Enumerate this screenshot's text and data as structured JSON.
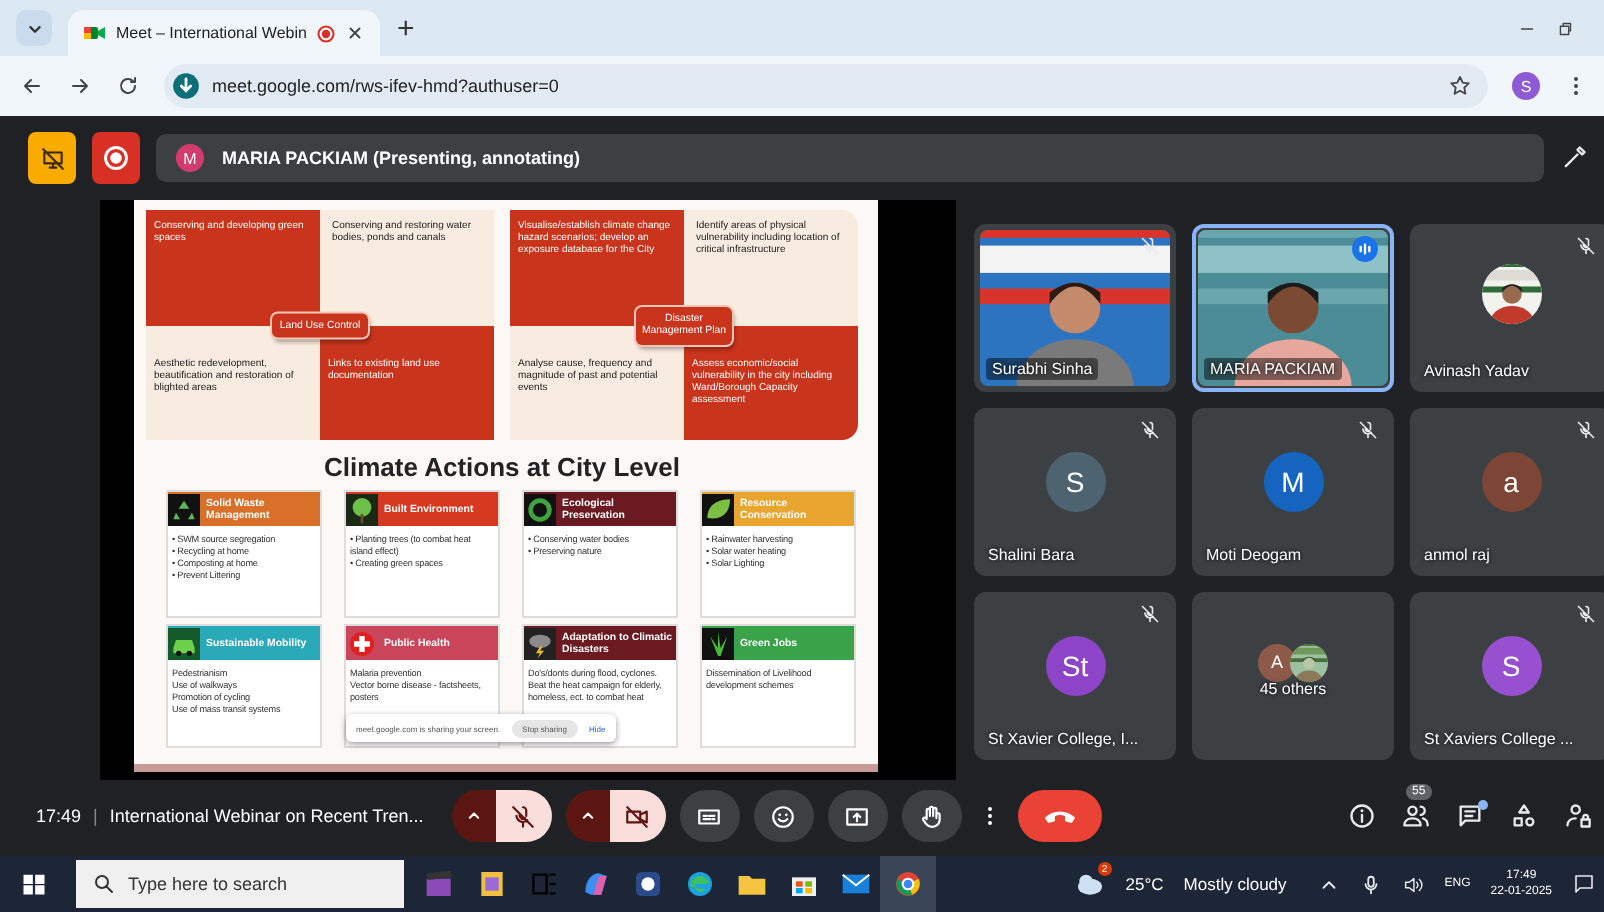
{
  "browser": {
    "tab_title": "Meet – International Webin",
    "new_tab": "+",
    "url": "meet.google.com/rws-ifev-hmd?authuser=0",
    "profile_initial": "S"
  },
  "meet_bar": {
    "presenter_initial": "M",
    "presenter": "MARIA PACKIAM (Presenting, annotating)"
  },
  "slide": {
    "quadrant_groups": [
      {
        "center": "Land Use Control",
        "cells": [
          {
            "text": "Conserving and developing green spaces",
            "color": "#c8341c"
          },
          {
            "text": "Conserving and restoring water bodies, ponds and canals",
            "color": "#f8ebe0"
          },
          {
            "text": "Aesthetic redevelopment, beautification and restoration of blighted areas",
            "color": "#f8ebe0"
          },
          {
            "text": "Links to existing  land use documentation",
            "color": "#c8341c"
          }
        ]
      },
      {
        "center": "Disaster Management Plan",
        "cells": [
          {
            "text": "Visualise/establish climate change hazard scenarios; develop an exposure database for the City",
            "color": "#c8341c"
          },
          {
            "text": "Identify areas of physical vulnerability including location of critical infrastructure",
            "color": "#f8ebe0"
          },
          {
            "text": "Analyse cause, frequency and magnitude of past and potential events",
            "color": "#f8ebe0"
          },
          {
            "text": "Assess economic/social vulnerability in the city including Ward/Borough Capacity assessment",
            "color": "#c8341c"
          }
        ]
      }
    ],
    "title": "Climate Actions at City Level",
    "cards": [
      {
        "title": "Solid Waste Management",
        "color": "#d9702a",
        "lines": [
          "• SWM source segregation",
          "• Recycling at home",
          "• Composting at home",
          "• Prevent Littering"
        ]
      },
      {
        "title": "Built Environment",
        "color": "#d6391f",
        "lines": [
          "• Planting trees (to combat heat island effect)",
          "• Creating green spaces"
        ]
      },
      {
        "title": "Ecological Preservation",
        "color": "#6b1a22",
        "lines": [
          "• Conserving water bodies",
          "• Preserving nature"
        ]
      },
      {
        "title": "Resource Conservation",
        "color": "#e8a530",
        "lines": [
          "• Rainwater harvesting",
          "• Solar water heating",
          "• Solar Lighting"
        ]
      },
      {
        "title": "Sustainable Mobility",
        "color": "#2aaab8",
        "lines": [
          "Pedestrianism",
          "Use of walkways",
          "Promotion of cycling",
          "Use of mass transit systems"
        ]
      },
      {
        "title": "Public Health",
        "color": "#c9455a",
        "lines": [
          "Malaria prevention",
          "Vector borne disease - factsheets, posters"
        ]
      },
      {
        "title": "Adaptation to Climatic Disasters",
        "color": "#6b1a22",
        "lines": [
          "Do's/donts during flood, cyclones. Beat the heat campaign for elderly, homeless, ect. to combat heat"
        ]
      },
      {
        "title": "Green Jobs",
        "color": "#3aa34a",
        "lines": [
          "Dissemination of Livelihood development schemes"
        ]
      }
    ],
    "share_notice": {
      "text": "meet.google.com is sharing your screen.",
      "stop": "Stop sharing",
      "hide": "Hide"
    }
  },
  "participants": [
    {
      "name": "Surabhi Sinha",
      "kind": "video",
      "muted": true,
      "speaking": false
    },
    {
      "name": "MARIA PACKIAM",
      "kind": "video",
      "muted": false,
      "speaking": true
    },
    {
      "name": "Avinash Yadav",
      "muted": true,
      "speaking": false
    },
    {
      "name": "Shalini Bara",
      "kind": "initial",
      "initial": "S",
      "color": "#4d6470",
      "muted": true,
      "speaking": false
    },
    {
      "name": "Moti Deogam",
      "kind": "initial",
      "initial": "M",
      "color": "#1565c0",
      "muted": true,
      "speaking": false
    },
    {
      "name": "anmol raj",
      "kind": "initial",
      "initial": "a",
      "color": "#7d4535",
      "muted": true,
      "speaking": false
    },
    {
      "name": "St Xavier College, I...",
      "kind": "initial",
      "initial": "St",
      "color": "#8e44c8",
      "muted": true,
      "speaking": false
    },
    {
      "name": "45 others",
      "kind": "others",
      "initial": "A",
      "color": "#8d5a4a",
      "muted": false,
      "speaking": false
    },
    {
      "name": "St Xaviers College ...",
      "kind": "initial",
      "initial": "S",
      "color": "#9650d0",
      "muted": true,
      "speaking": false
    }
  ],
  "call_bar": {
    "time": "17:49",
    "separator": "|",
    "meeting_title": "International Webinar on Recent Tren...",
    "mic_muted": true,
    "camera_off": true,
    "people_count": "55",
    "chat_unread": true
  },
  "taskbar": {
    "search_placeholder": "Type here to search",
    "weather_badge": "2",
    "temperature": "25°C",
    "weather": "Mostly cloudy",
    "language": "ENG",
    "time": "17:49",
    "date": "22-01-2025"
  }
}
